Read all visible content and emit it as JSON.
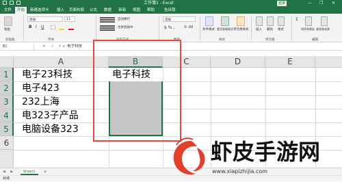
{
  "window": {
    "title": "工作簿1 - Excel",
    "user": "登录",
    "minimize": "—",
    "restore": "❐",
    "close": "✕"
  },
  "menu": {
    "tabs": [
      "文件",
      "开始",
      "新建选项卡",
      "插入",
      "页面布局",
      "公式",
      "数据",
      "审阅",
      "视图",
      "帮助",
      "告诉我"
    ],
    "active": "开始"
  },
  "ribbon": {
    "groups": [
      "剪贴板",
      "字体",
      "对齐方式",
      "数字",
      "样式",
      "单元格",
      "编辑"
    ],
    "font_name": "等线",
    "font_size": "11",
    "wrap_text": "自动换行",
    "merge_center": "合并后居中",
    "number_format": "常规",
    "paste": "粘贴",
    "cond_format": "条件格式",
    "table_format": "套用表格格式",
    "cell_style": "单元格样式",
    "insert": "插入",
    "delete": "删除",
    "format": "格式",
    "sort_filter": "排序和筛选",
    "find_select": "查找和选择"
  },
  "formula_bar": {
    "name_box": "B1",
    "icons": "✕ ✓ fx",
    "value": "电子科技"
  },
  "sheet": {
    "columns": [
      "A",
      "B",
      "C",
      "D",
      "E"
    ],
    "rows": [
      "1",
      "2",
      "3",
      "4",
      "5",
      "6"
    ],
    "cells": {
      "A1": "电子23科技",
      "A2": "电子423",
      "A3": "232上海",
      "A4": "电323子产品",
      "A5": "电脑设备323",
      "B1": "电子科技"
    },
    "tab": "Sheet1",
    "add_tab": "+",
    "nav": "◀ ▶"
  },
  "status": {
    "text": "就绪"
  },
  "watermark": {
    "title": "虾皮手游网",
    "url": "www.xiapizhijia.com"
  },
  "colors": {
    "excel_green": "#217346",
    "highlight_red": "#e04a3a",
    "selection_gray": "#c6c6c6"
  }
}
